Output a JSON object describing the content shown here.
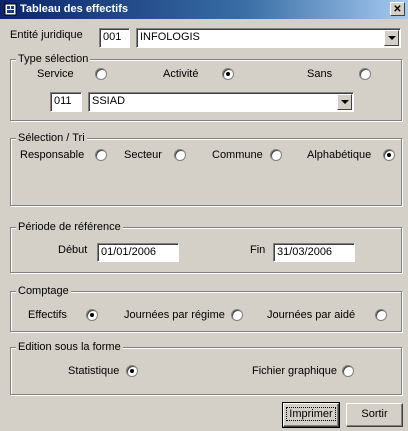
{
  "window": {
    "title": "Tableau des effectifs",
    "close_glyph": "✕"
  },
  "entite": {
    "label": "Entité juridique",
    "code": "001",
    "name": "INFOLOGIS"
  },
  "type_selection": {
    "legend": "Type sélection",
    "options": [
      {
        "label": "Service",
        "selected": false
      },
      {
        "label": "Activité",
        "selected": true
      },
      {
        "label": "Sans",
        "selected": false
      }
    ],
    "code": "011",
    "name": "SSIAD"
  },
  "selection_tri": {
    "legend": "Sélection / Tri",
    "options": [
      {
        "label": "Responsable",
        "selected": false
      },
      {
        "label": "Secteur",
        "selected": false
      },
      {
        "label": "Commune",
        "selected": false
      },
      {
        "label": "Alphabétique",
        "selected": true
      }
    ]
  },
  "periode": {
    "legend": "Période de référence",
    "debut_label": "Début",
    "debut_value": "01/01/2006",
    "fin_label": "Fin",
    "fin_value": "31/03/2006"
  },
  "comptage": {
    "legend": "Comptage",
    "options": [
      {
        "label": "Effectifs",
        "selected": true
      },
      {
        "label": "Journées par régime",
        "selected": false
      },
      {
        "label": "Journées par aidé",
        "selected": false
      }
    ]
  },
  "edition": {
    "legend": "Edition sous la forme",
    "options": [
      {
        "label": "Statistique",
        "selected": true
      },
      {
        "label": "Fichier graphique",
        "selected": false
      }
    ]
  },
  "buttons": {
    "print": "Imprimer",
    "exit": "Sortir"
  }
}
